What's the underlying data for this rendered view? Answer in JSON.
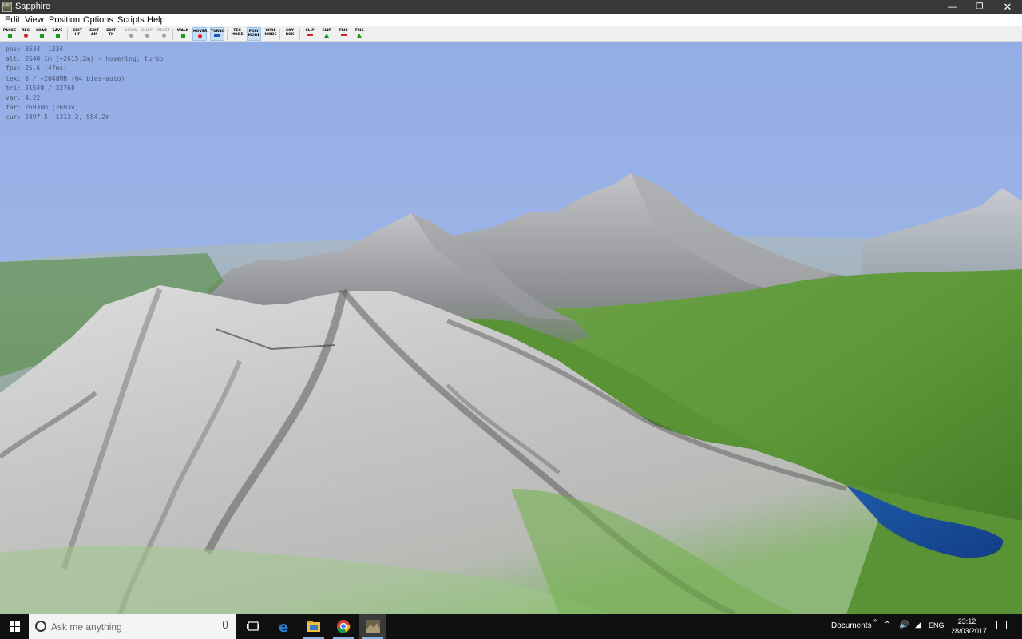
{
  "window": {
    "title": "Sapphire",
    "app_icon_text": "L3DT",
    "controls": {
      "minimize": "—",
      "maximize": "❐",
      "close": "✕"
    }
  },
  "menu": [
    "Edit",
    "View",
    "Position",
    "Options",
    "Scripts",
    "Help"
  ],
  "toolbar": [
    {
      "label": "PAUSE",
      "marker": "green",
      "enabled": true
    },
    {
      "label": "REC",
      "marker": "red",
      "enabled": true
    },
    {
      "label": "LOAD",
      "marker": "green",
      "enabled": true
    },
    {
      "label": "SAVE",
      "marker": "green",
      "enabled": true
    },
    {
      "label": "EDIT\nHF",
      "marker": "",
      "enabled": true
    },
    {
      "label": "EDIT\nAM",
      "marker": "",
      "enabled": true
    },
    {
      "label": "EDIT\nTX",
      "marker": "",
      "enabled": true
    },
    {
      "label": "SHOW",
      "marker": "grey",
      "enabled": false
    },
    {
      "label": "SNAP",
      "marker": "grey",
      "enabled": false
    },
    {
      "label": "RESET",
      "marker": "grey",
      "enabled": false
    },
    {
      "label": "WALK",
      "marker": "green",
      "enabled": true
    },
    {
      "label": "HOVER",
      "marker": "red",
      "enabled": true,
      "active": true
    },
    {
      "label": "TURBO",
      "marker": "blue",
      "enabled": true,
      "active": true
    },
    {
      "label": "TEX\nMODE",
      "marker": "",
      "enabled": true
    },
    {
      "label": "POLY\nMODE",
      "marker": "",
      "enabled": true,
      "active": true
    },
    {
      "label": "WIRE\nMODE",
      "marker": "",
      "enabled": true
    },
    {
      "label": "SKY\nBOX",
      "marker": "",
      "enabled": true
    },
    {
      "label": "CLIP",
      "marker": "rbar",
      "enabled": true
    },
    {
      "label": "CLIP",
      "marker": "gup",
      "enabled": true
    },
    {
      "label": "TRIS",
      "marker": "rbar",
      "enabled": true
    },
    {
      "label": "TRIS",
      "marker": "gup",
      "enabled": true
    }
  ],
  "hud": {
    "pos": "pos: 3534, 1334",
    "alt": "alt: 2640.1m (+2615.2m) - hovering, turbo",
    "fps": "fps: 25.6 (47ms)",
    "tex": "tex: 0 / ~2048MB (64 bias-auto)",
    "tri": "tri: 31549 / 32768",
    "var": "var: 4.22",
    "far": "far: 26930m (2693v)",
    "cur": "cur: 2497.5, 1313.2, 584.2m"
  },
  "scene": {
    "sky_top": "#93ade6",
    "sky_horizon": "#a8bde2",
    "rock": "#b8b8b8",
    "grass": "#5c9a38",
    "water": "#1a4f9c"
  },
  "taskbar": {
    "search_placeholder": "Ask me anything",
    "apps": [
      "task-view",
      "edge",
      "file-explorer",
      "chrome",
      "l3dt"
    ],
    "toolbar_label": "Documents",
    "toolbar_chevron": "»",
    "language": "ENG",
    "time": "23:12",
    "date": "28/03/2017"
  }
}
